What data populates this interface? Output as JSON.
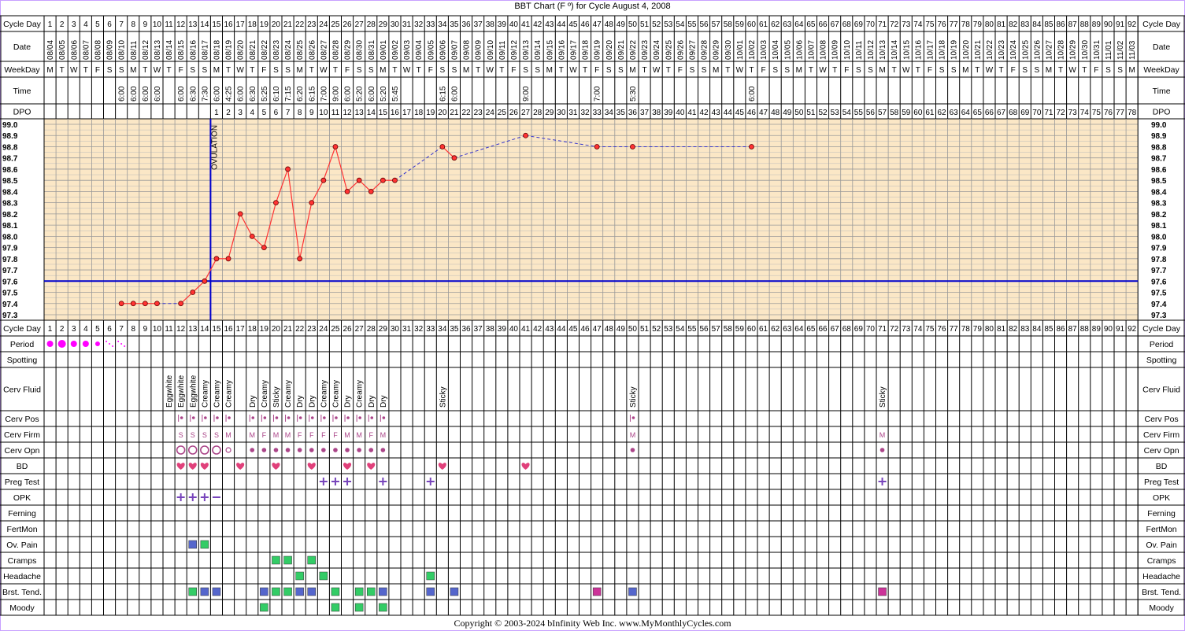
{
  "title": "BBT Chart (F º) for Cycle August 4, 2008",
  "copyright": "Copyright © 2003-2024 bInfinity Web Inc.     www.MyMonthlyCycles.com",
  "row_labels": {
    "cycle_day": "Cycle Day",
    "date": "Date",
    "weekday": "WeekDay",
    "time": "Time",
    "dpo": "DPO",
    "period": "Period",
    "spotting": "Spotting",
    "cerv_fluid": "Cerv Fluid",
    "cerv_pos": "Cerv Pos",
    "cerv_firm": "Cerv Firm",
    "cerv_opn": "Cerv Opn",
    "bd": "BD",
    "preg_test": "Preg Test",
    "opk": "OPK",
    "ferning": "Ferning",
    "fertmon": "FertMon",
    "ov_pain": "Ov. Pain",
    "cramps": "Cramps",
    "headache": "Headache",
    "brst_tend": "Brst. Tend.",
    "moody": "Moody"
  },
  "ovulation_label": "OVULATION",
  "colors": {
    "grid_bg": "#fbe7c6",
    "temp_line": "#ff3333",
    "dashed_line": "#3333cc",
    "coverline": "#0000cc",
    "period_dot": "#ff00ff",
    "heart": "#e0407a",
    "plus": "#7744bb",
    "green_box": "#33cc66",
    "blue_box": "#5566cc",
    "magenta_box": "#cc3399",
    "cervix": "#aa4488",
    "border": "#c8a0ff"
  },
  "dates": [
    "08/04",
    "08/05",
    "08/06",
    "08/07",
    "08/08",
    "08/09",
    "08/10",
    "08/11",
    "08/12",
    "08/13",
    "08/14",
    "08/15",
    "08/16",
    "08/17",
    "08/18",
    "08/19",
    "08/20",
    "08/21",
    "08/22",
    "08/23",
    "08/24",
    "08/25",
    "08/26",
    "08/27",
    "08/28",
    "08/29",
    "08/30",
    "08/31",
    "09/01",
    "09/02",
    "09/03",
    "09/04",
    "09/05",
    "09/06",
    "09/07",
    "09/08",
    "09/09",
    "09/10",
    "09/11",
    "09/12",
    "09/13",
    "09/14",
    "09/15",
    "09/16",
    "09/17",
    "09/18",
    "09/19",
    "09/20",
    "09/21",
    "09/22",
    "09/23",
    "09/24",
    "09/25",
    "09/26",
    "09/27",
    "09/28",
    "09/29",
    "09/30",
    "10/01",
    "10/02",
    "10/03",
    "10/04",
    "10/05",
    "10/06",
    "10/07",
    "10/08",
    "10/09",
    "10/10",
    "10/11",
    "10/12",
    "10/13",
    "10/14",
    "10/15",
    "10/16",
    "10/17",
    "10/18",
    "10/19",
    "10/20",
    "10/21",
    "10/22",
    "10/23",
    "10/24",
    "10/25",
    "10/26",
    "10/27",
    "10/28",
    "10/29",
    "10/30",
    "10/31",
    "11/01",
    "11/02",
    "11/03"
  ],
  "weekdays": [
    "M",
    "T",
    "W",
    "T",
    "F",
    "S",
    "S",
    "M",
    "T",
    "W",
    "T",
    "F",
    "S",
    "S",
    "M",
    "T",
    "W",
    "T",
    "F",
    "S",
    "S",
    "M",
    "T",
    "W",
    "T",
    "F",
    "S",
    "S",
    "M",
    "T",
    "W",
    "T",
    "F",
    "S",
    "S",
    "M",
    "T",
    "W",
    "T",
    "F",
    "S",
    "S",
    "M",
    "T",
    "W",
    "T",
    "F",
    "S",
    "S",
    "M",
    "T",
    "W",
    "T",
    "F",
    "S",
    "S",
    "M",
    "T",
    "W",
    "T",
    "F",
    "S",
    "S",
    "M",
    "T",
    "W",
    "T",
    "F",
    "S",
    "S",
    "M",
    "T",
    "W",
    "T",
    "F",
    "S",
    "S",
    "M",
    "T",
    "W",
    "T",
    "F",
    "S",
    "S",
    "M",
    "T",
    "W",
    "T",
    "F",
    "S",
    "S",
    "M"
  ],
  "times": {
    "7": "6:00",
    "8": "6:00",
    "9": "6:00",
    "10": "6:00",
    "12": "6:00",
    "13": "6:30",
    "14": "7:30",
    "15": "6:00",
    "16": "4:25",
    "17": "6:00",
    "18": "6:30",
    "19": "5:25",
    "20": "6:10",
    "21": "7:15",
    "22": "6:20",
    "23": "6:15",
    "24": "7:00",
    "25": "9:00",
    "26": "6:00",
    "27": "5:20",
    "28": "6:00",
    "29": "5:20",
    "30": "5:45",
    "34": "6:15",
    "35": "6:00",
    "41": "9:00",
    "47": "7:00",
    "50": "5:30",
    "60": "6:00"
  },
  "dpo_start_day": 15,
  "dpo_count": 78,
  "cerv_fluid": {
    "11": "Eggwhite",
    "12": "Eggwhite",
    "13": "Eggwhite",
    "14": "Creamy",
    "15": "Creamy",
    "16": "Creamy",
    "18": "Dry",
    "19": "Creamy",
    "20": "Sticky",
    "21": "Creamy",
    "22": "Dry",
    "23": "Dry",
    "24": "Creamy",
    "25": "Creamy",
    "26": "Dry",
    "27": "Creamy",
    "28": "Dry",
    "29": "Dry",
    "34": "Sticky",
    "50": "Sticky",
    "71": "Sticky"
  },
  "cerv_firm": {
    "12": "S",
    "13": "S",
    "14": "S",
    "15": "S",
    "16": "M",
    "18": "M",
    "19": "F",
    "20": "M",
    "21": "M",
    "22": "F",
    "23": "F",
    "24": "F",
    "25": "F",
    "26": "M",
    "27": "M",
    "28": "F",
    "29": "M",
    "50": "M",
    "71": "M"
  },
  "cerv_pos_days": [
    12,
    13,
    14,
    15,
    16,
    18,
    19,
    20,
    21,
    22,
    23,
    24,
    25,
    26,
    27,
    28,
    29,
    50
  ],
  "cerv_opn": {
    "12": "open",
    "13": "open",
    "14": "open",
    "15": "open",
    "16": "small",
    "18": "dot",
    "19": "dot",
    "20": "dot",
    "21": "dot",
    "22": "dot",
    "23": "dot",
    "24": "dot",
    "25": "dot",
    "26": "dot",
    "27": "dot",
    "28": "dot",
    "29": "dot",
    "50": "dot",
    "71": "dot"
  },
  "period": {
    "1": "medium",
    "2": "heavy",
    "3": "medium",
    "4": "medium",
    "5": "light",
    "6": "spotting",
    "7": "spotting"
  },
  "bd_days": [
    12,
    13,
    14,
    17,
    20,
    23,
    26,
    28,
    34,
    41
  ],
  "preg_test": {
    "24": "+",
    "25": "+",
    "26": "+",
    "29": "+",
    "33": "+",
    "71": "+"
  },
  "opk": {
    "12": "+",
    "13": "+",
    "14": "+",
    "15": "−"
  },
  "ov_pain": {
    "13": "blue",
    "14": "green"
  },
  "cramps": {
    "20": "green",
    "21": "green",
    "23": "green"
  },
  "headache": {
    "22": "green",
    "24": "green",
    "33": "green"
  },
  "brst_tend": {
    "13": "green",
    "14": "blue",
    "15": "blue",
    "19": "blue",
    "20": "green",
    "21": "green",
    "22": "blue",
    "23": "blue",
    "25": "green",
    "27": "green",
    "28": "green",
    "29": "blue",
    "33": "blue",
    "35": "blue",
    "47": "magenta",
    "50": "blue",
    "71": "magenta"
  },
  "moody": {
    "19": "green",
    "25": "green",
    "27": "green",
    "29": "green"
  },
  "chart_data": {
    "type": "line",
    "title": "BBT Chart (F º) for Cycle August 4, 2008",
    "xlabel": "Cycle Day",
    "ylabel": "",
    "ylim": [
      97.3,
      99.0
    ],
    "y_ticks": [
      "99.0",
      "98.9",
      "98.8",
      "98.7",
      "98.6",
      "98.5",
      "98.4",
      "98.3",
      "98.2",
      "98.1",
      "98.0",
      "97.9",
      "97.8",
      "97.7",
      "97.6",
      "97.5",
      "97.4",
      "97.3"
    ],
    "coverline": 97.6,
    "ovulation_day": 14,
    "grid": true,
    "points": [
      {
        "day": 7,
        "temp": 97.4
      },
      {
        "day": 8,
        "temp": 97.4
      },
      {
        "day": 9,
        "temp": 97.4
      },
      {
        "day": 10,
        "temp": 97.4
      },
      {
        "day": 12,
        "temp": 97.4
      },
      {
        "day": 13,
        "temp": 97.5
      },
      {
        "day": 14,
        "temp": 97.6
      },
      {
        "day": 15,
        "temp": 97.8
      },
      {
        "day": 16,
        "temp": 97.8
      },
      {
        "day": 17,
        "temp": 98.2
      },
      {
        "day": 18,
        "temp": 98.0
      },
      {
        "day": 19,
        "temp": 97.9
      },
      {
        "day": 20,
        "temp": 98.3
      },
      {
        "day": 21,
        "temp": 98.6
      },
      {
        "day": 22,
        "temp": 97.8
      },
      {
        "day": 23,
        "temp": 98.3
      },
      {
        "day": 24,
        "temp": 98.5
      },
      {
        "day": 25,
        "temp": 98.8
      },
      {
        "day": 26,
        "temp": 98.4
      },
      {
        "day": 27,
        "temp": 98.5
      },
      {
        "day": 28,
        "temp": 98.4
      },
      {
        "day": 29,
        "temp": 98.5
      },
      {
        "day": 30,
        "temp": 98.5
      },
      {
        "day": 34,
        "temp": 98.8
      },
      {
        "day": 35,
        "temp": 98.7
      },
      {
        "day": 41,
        "temp": 98.9
      },
      {
        "day": 47,
        "temp": 98.8
      },
      {
        "day": 50,
        "temp": 98.8
      },
      {
        "day": 60,
        "temp": 98.8
      }
    ]
  }
}
